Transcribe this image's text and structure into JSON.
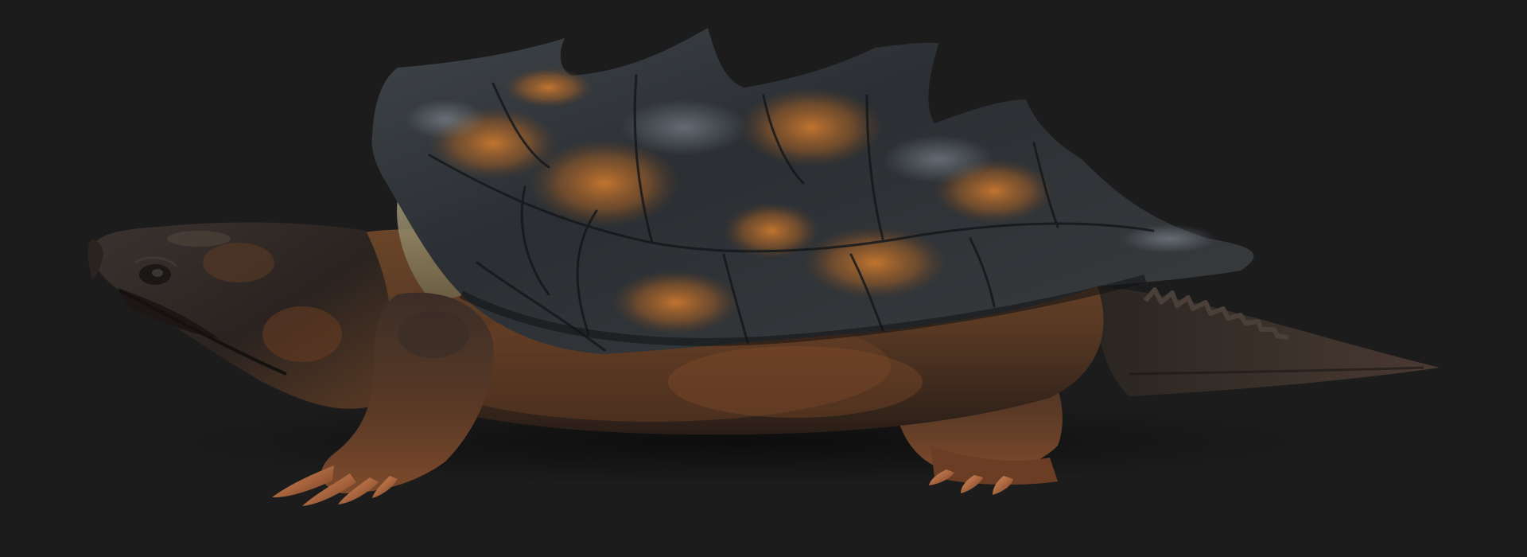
{
  "scene": {
    "subject": "alligator-snapping-turtle-3d-render",
    "background_color": "#1c1c1d",
    "palette": {
      "shell_dark": "#2b2f33",
      "shell_mid": "#4a4c4f",
      "shell_orange": "#b5692a",
      "skin_dark": "#2a2320",
      "skin_brown": "#5a3a24",
      "skin_rust": "#8a4f2a",
      "plastron_pale": "#8c8366",
      "claw": "#c97c4f"
    }
  }
}
